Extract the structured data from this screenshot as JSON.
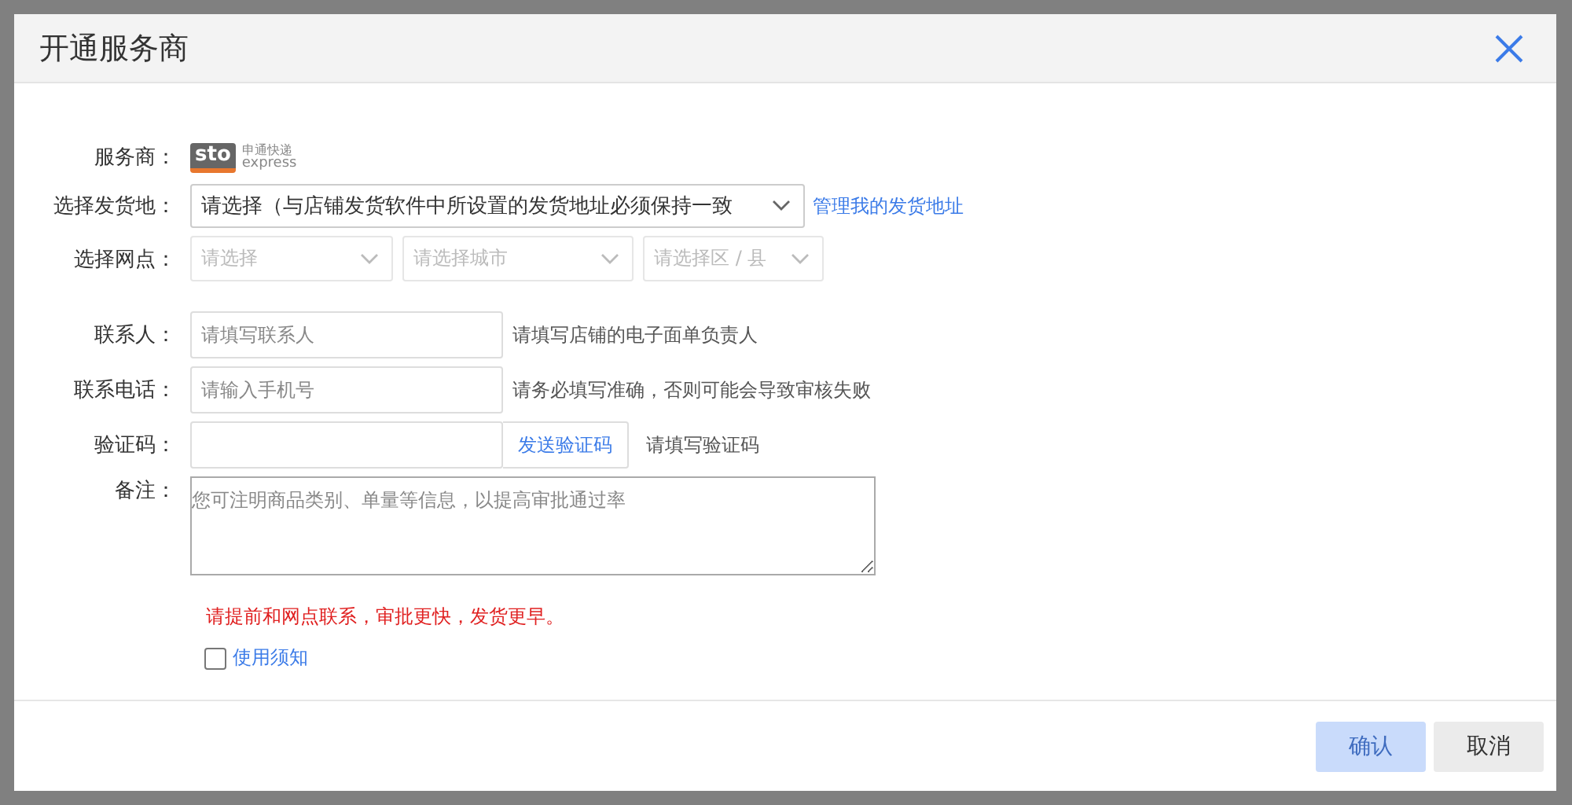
{
  "dialog": {
    "title": "开通服务商"
  },
  "provider": {
    "label": "服务商：",
    "logo_mark": "sto",
    "logo_name": "申通快递",
    "logo_sub": "express"
  },
  "origin": {
    "label": "选择发货地：",
    "value": "请选择（与店铺发货软件中所设置的发货地址必须保持一致",
    "link": "管理我的发货地址"
  },
  "outlet": {
    "label": "选择网点：",
    "selects": [
      {
        "placeholder": "请选择",
        "disabled": true
      },
      {
        "placeholder": "请选择城市",
        "disabled": true
      },
      {
        "placeholder": "请选择区 / 县",
        "disabled": true
      }
    ]
  },
  "fields": [
    {
      "label": "联系人：",
      "placeholder": "请填写联系人",
      "hint": "请填写店铺的电子面单负责人"
    },
    {
      "label": "联系电话：",
      "placeholder": "请输入手机号",
      "hint": "请务必填写准确，否则可能会导致审核失败"
    }
  ],
  "code": {
    "label": "验证码：",
    "button": "发送验证码",
    "hint": "请填写验证码"
  },
  "remark": {
    "label": "备注：",
    "placeholder": "您可注明商品类别、单量等信息，以提高审批通过率"
  },
  "warning": "请提前和网点联系，审批更快，发货更早。",
  "agreement": {
    "checked": false,
    "link": "使用须知"
  },
  "buttons": [
    {
      "label": "确认",
      "kind": "primary",
      "disabled": true
    },
    {
      "label": "取消",
      "kind": "default",
      "disabled": false
    }
  ]
}
